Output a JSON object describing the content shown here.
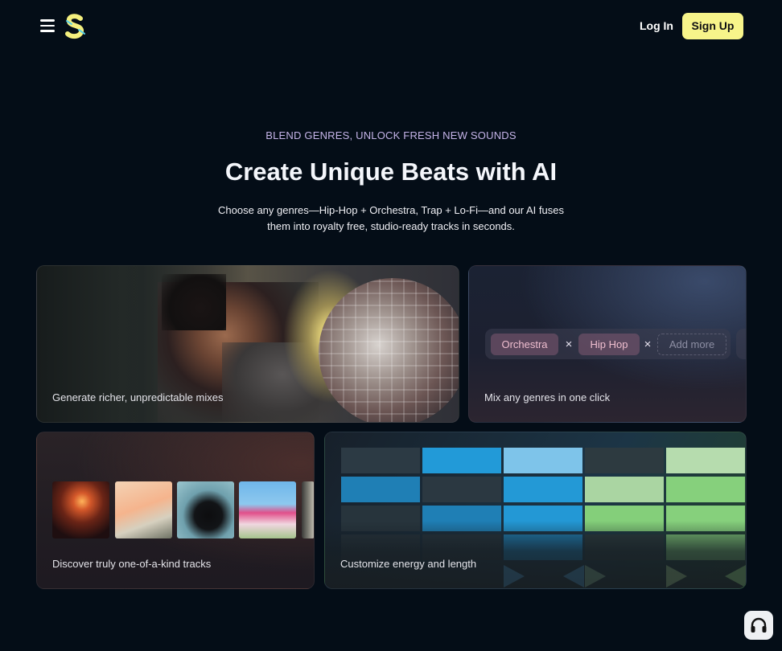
{
  "header": {
    "login_label": "Log In",
    "signup_label": "Sign Up",
    "menu_icon": "hamburger-menu-icon",
    "logo_icon": "s-logo-icon",
    "signup_color": "#f7f48a"
  },
  "hero": {
    "eyebrow": "BLEND GENRES, UNLOCK FRESH NEW SOUNDS",
    "title": "Create Unique Beats with AI",
    "subtitle": "Choose any genres—Hip-Hop + Orchestra, Trap + Lo-Fi—and our AI fuses them into royalty free, studio-ready tracks in seconds."
  },
  "features": {
    "mixes_label": "Generate richer, unpredictable mixes",
    "genres_label": "Mix any genres in one click",
    "discover_label": "Discover truly one-of-a-kind tracks",
    "energy_label": "Customize energy and length"
  },
  "genre_chips": {
    "chips": [
      "Orchestra",
      "Hip Hop"
    ],
    "separator": "×",
    "add_more": "Add more"
  },
  "support": {
    "icon": "headphones-icon"
  },
  "colors": {
    "background": "#040d17",
    "accent_yellow": "#f7f48a",
    "eyebrow": "#c5b4e8",
    "chip_text": "#f0bfd0"
  }
}
